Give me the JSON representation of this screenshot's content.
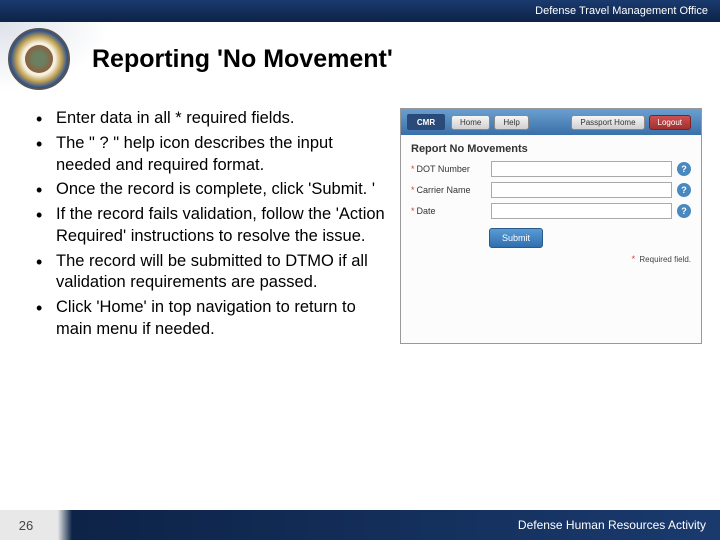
{
  "header": {
    "office": "Defense Travel Management Office"
  },
  "title": "Reporting 'No Movement'",
  "bullets": [
    "Enter data in all * required fields.",
    "The \" ? \" help icon describes the input needed and required format.",
    "Once the record is complete, click 'Submit. '",
    "If the record fails validation, follow the 'Action Required' instructions to resolve the issue.",
    "The record will be submitted to DTMO if all validation requirements are passed.",
    "Click 'Home' in top navigation to return to main menu if needed."
  ],
  "screenshot": {
    "logo": "CMR",
    "nav": {
      "home": "Home",
      "help": "Help",
      "passport": "Passport Home",
      "logout": "Logout"
    },
    "section": "Report No Movements",
    "fields": [
      {
        "star": "*",
        "label": "DOT Number"
      },
      {
        "star": "*",
        "label": "Carrier Name"
      },
      {
        "star": "*",
        "label": "Date"
      }
    ],
    "submit": "Submit",
    "req_marker": "*",
    "req_text": "Required field."
  },
  "footer": {
    "page": "26",
    "org": "Defense Human Resources Activity"
  }
}
